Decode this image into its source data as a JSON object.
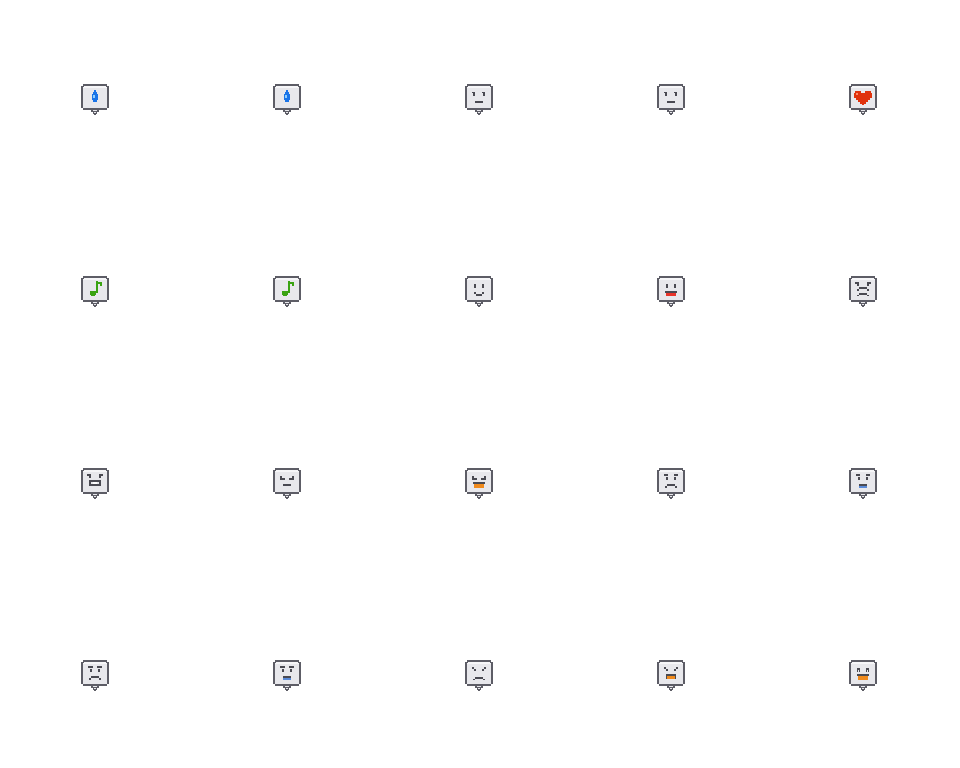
{
  "palette": {
    "outline": "#5d5d66",
    "face_fill": "#e8e8ec",
    "face_light": "#f6f6f8",
    "feature": "#4a4a52",
    "water_blue": "#1a74e8",
    "water_highlight": "#8fd0ff",
    "heart_red": "#e0310c",
    "note_green": "#3aa312",
    "mouth_red": "#e8342a",
    "mouth_orange": "#f08a1c",
    "tear_blue": "#5a8ad8"
  },
  "emotes": [
    {
      "icon": "sweat-drop-icon"
    },
    {
      "icon": "sweat-drop-icon"
    },
    {
      "icon": "neutral-face-icon"
    },
    {
      "icon": "neutral-face-icon"
    },
    {
      "icon": "heart-icon"
    },
    {
      "icon": "music-note-icon"
    },
    {
      "icon": "music-note-icon"
    },
    {
      "icon": "smile-face-icon"
    },
    {
      "icon": "happy-tongue-face-icon"
    },
    {
      "icon": "angry-face-icon"
    },
    {
      "icon": "angry-grin-face-icon"
    },
    {
      "icon": "content-face-icon"
    },
    {
      "icon": "laughing-face-icon"
    },
    {
      "icon": "worried-face-icon"
    },
    {
      "icon": "sad-tear-face-icon"
    },
    {
      "icon": "frown-face-icon"
    },
    {
      "icon": "crying-face-icon"
    },
    {
      "icon": "sulky-face-icon"
    },
    {
      "icon": "shouting-face-icon"
    },
    {
      "icon": "grin-open-face-icon"
    }
  ]
}
